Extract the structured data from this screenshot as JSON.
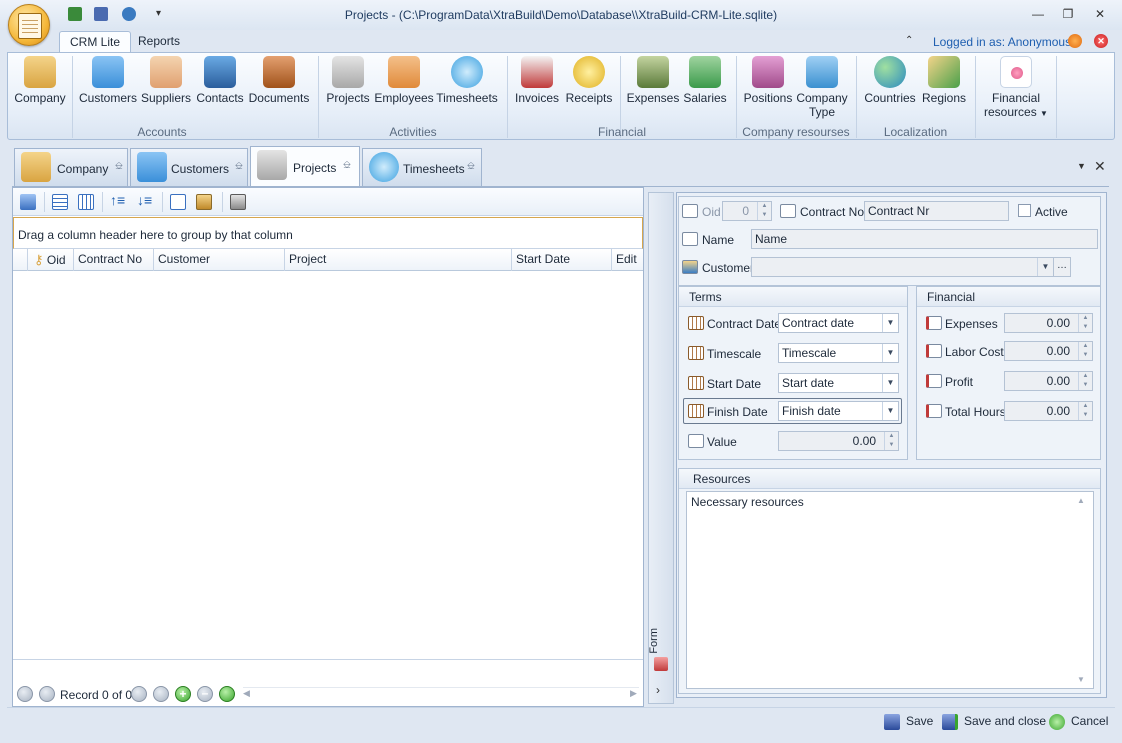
{
  "window": {
    "title": "Projects -  (C:\\ProgramData\\XtraBuild\\Demo\\Database\\\\XtraBuild-CRM-Lite.sqlite)",
    "logged_in": "Logged in as: Anonymous"
  },
  "ribbon_tabs": [
    "CRM Lite",
    "Reports"
  ],
  "ribbon": {
    "buttons": [
      {
        "label": "Company",
        "icon": "bank-icon",
        "color": "#d9a441"
      },
      {
        "label": "Customers",
        "icon": "building-icon",
        "color": "#3a8fd9"
      },
      {
        "label": "Suppliers",
        "icon": "handshake-icon",
        "color": "#e0a070"
      },
      {
        "label": "Contacts",
        "icon": "address-book-icon",
        "color": "#3a7dc4"
      },
      {
        "label": "Documents",
        "icon": "briefcase-icon",
        "color": "#c0652a"
      },
      {
        "label": "Projects",
        "icon": "tools-icon",
        "color": "#c84a3a"
      },
      {
        "label": "Employees",
        "icon": "people-icon",
        "color": "#e08a3a"
      },
      {
        "label": "Timesheets",
        "icon": "clock-icon",
        "color": "#3aa0e0"
      },
      {
        "label": "Invoices",
        "icon": "invoice-icon",
        "color": "#c03a3a"
      },
      {
        "label": "Receipts",
        "icon": "coins-icon",
        "color": "#e0b020"
      },
      {
        "label": "Expenses",
        "icon": "money-icon",
        "color": "#7a9a4a"
      },
      {
        "label": "Salaries",
        "icon": "salary-icon",
        "color": "#3a9a4a"
      },
      {
        "label": "Positions",
        "icon": "org-chart-icon",
        "color": "#c04a9a"
      },
      {
        "label": "Company",
        "label2": "Type",
        "icon": "company-type-icon",
        "color": "#3a90d0"
      },
      {
        "label": "Countries",
        "icon": "globe-icon",
        "color": "#2a8ac0"
      },
      {
        "label": "Regions",
        "icon": "map-icon",
        "color": "#4aa04a"
      },
      {
        "label": "Financial",
        "label2": "resources",
        "icon": "financial-resources-icon",
        "color": "#e05a8a"
      }
    ],
    "groups": [
      "Accounts",
      "Activities",
      "Financial",
      "Company resourses",
      "Localization"
    ]
  },
  "doc_tabs": [
    {
      "label": "Company",
      "icon": "bank-icon",
      "color": "#d9a441"
    },
    {
      "label": "Customers",
      "icon": "building-icon",
      "color": "#3a8fd9"
    },
    {
      "label": "Projects",
      "icon": "tools-icon",
      "color": "#c84a3a"
    },
    {
      "label": "Timesheets",
      "icon": "clock-icon",
      "color": "#3aa0e0"
    }
  ],
  "grid": {
    "group_hint": "Drag a column header here to group by that column",
    "columns": [
      "Oid",
      "Contract No",
      "Customer",
      "Project",
      "Start Date",
      "Edit"
    ],
    "record": "Record 0 of 0"
  },
  "form": {
    "side_label": "Form",
    "oid_label": "Oid",
    "oid_value": "0",
    "contract_no_label": "Contract No",
    "contract_no_value": "Contract Nr",
    "active_label": "Active",
    "name_label": "Name",
    "name_value": "Name",
    "customer_label": "Customer",
    "customer_value": "",
    "terms": {
      "title": "Terms",
      "contract_date_label": "Contract Date",
      "contract_date_value": "Contract date",
      "timescale_label": "Timescale",
      "timescale_value": "Timescale",
      "start_date_label": "Start Date",
      "start_date_value": "Start date",
      "finish_date_label": "Finish Date",
      "finish_date_value": "Finish date",
      "value_label": "Value",
      "value_value": "0.00"
    },
    "financial": {
      "title": "Financial",
      "expenses_label": "Expenses",
      "expenses_value": "0.00",
      "labor_cost_label": "Labor Cost",
      "labor_cost_value": "0.00",
      "profit_label": "Profit",
      "profit_value": "0.00",
      "total_hours_label": "Total Hours",
      "total_hours_value": "0.00"
    },
    "resources": {
      "title": "Resources",
      "value": "Necessary resources"
    }
  },
  "actions": {
    "save": "Save",
    "save_close": "Save and close",
    "cancel": "Cancel"
  }
}
